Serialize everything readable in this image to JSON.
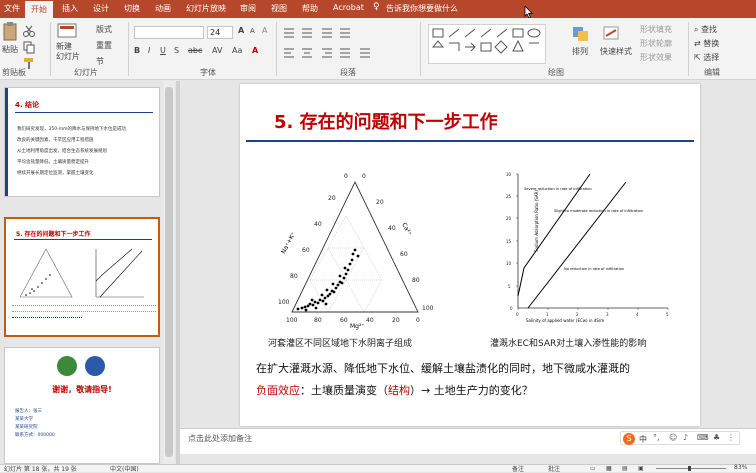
{
  "tabs": {
    "file": "文件",
    "home": "开始",
    "insert": "插入",
    "design": "设计",
    "transitions": "切换",
    "animations": "动画",
    "slideshow": "幻灯片放映",
    "review": "审阅",
    "view": "视图",
    "help": "帮助",
    "acrobat": "Acrobat",
    "tell_me": "告诉我你想要做什么"
  },
  "ribbon": {
    "paste": "粘贴",
    "new_slide": "新建\n幻灯片",
    "layout": "版式",
    "reset": "重置",
    "section": "节",
    "font_size": "24",
    "arrange": "排列",
    "quick_styles": "快速样式",
    "shape_fill": "形状填充",
    "shape_outline": "形状轮廓",
    "shape_effects": "形状效果",
    "find": "查找",
    "replace": "替换",
    "select": "选择",
    "groups": {
      "clipboard": "剪贴板",
      "slides": "幻灯片",
      "font": "字体",
      "paragraph": "段落",
      "drawing": "绘图",
      "editing": "编辑"
    }
  },
  "thumbs": {
    "t17_title": "4. 结论",
    "t17_lines": [
      "我们研究发现，350-mm的降水与保持地下水位是成功",
      "改良的关键因素，干旱区应用工程措施",
      "从土地利用角度出发，结合生态系统发展规划",
      "平均含盐量降低，土壤质量稳定提升",
      "继续开展长期定位监测，掌握土壤变化"
    ],
    "t18_title": "5. 存在的问题和下一步工作",
    "t19_thanks": "谢谢，敬请指导!",
    "t19_lines": [
      "报告人：张三",
      "某某大学",
      "某某研究院",
      "联系方式：000000"
    ]
  },
  "slide": {
    "title": "5. 存在的问题和下一步工作",
    "fig1_caption": "河套灌区不同区域地下水阴离子组成",
    "fig2_caption": "灌溉水EC和SAR对土壤入渗性能的影响",
    "body_line1": "在扩大灌溉水源、降低地下水位、缓解土壤盐渍化的同时，地下微咸水灌溉的",
    "body_line2_red": "负面效应",
    "body_line2_mid": "：土壤质量演变（",
    "body_line2_paren": "结构",
    "body_line2_end": "）→ 土地生产力的变化？",
    "tri_labels": {
      "left": "Na⁺+K⁺",
      "right": "Ca²⁺",
      "bottom": "Mg²⁺"
    },
    "tri_ticks_left": [
      "100",
      "80",
      "60",
      "40",
      "20",
      "0"
    ],
    "tri_ticks_right": [
      "0",
      "20",
      "40",
      "60",
      "80",
      "100"
    ],
    "tri_ticks_bottom": [
      "100",
      "80",
      "60",
      "40",
      "20",
      "0"
    ],
    "fig2_ylabel": "Sodium Adsorption Ratio (SAR)",
    "fig2_xlabel": "Salinity of applied water (ECw) in dS/m",
    "fig2_note_severe": "Severe reduction in rate of infiltration",
    "fig2_note_slight": "Slight to moderate reduction in rate of infiltration",
    "fig2_note_none": "No reduction in rate of infiltration",
    "fig2_yticks": [
      "30",
      "25",
      "20",
      "15",
      "10",
      "5",
      "0"
    ],
    "fig2_xticks": [
      "0",
      "1",
      "2",
      "3",
      "4",
      "5"
    ]
  },
  "notes_placeholder": "点击此处添加备注",
  "status": {
    "slide_info": "幻灯片 第 18 张，共 19 张",
    "lang": "中文(中国)",
    "notes_btn": "备注",
    "comments_btn": "批注",
    "zoom": "83%"
  },
  "ime": {
    "lang": "中"
  },
  "colors": {
    "accent": "#b7472a",
    "title_red": "#c00000",
    "rule_blue": "#1f3f8f"
  }
}
